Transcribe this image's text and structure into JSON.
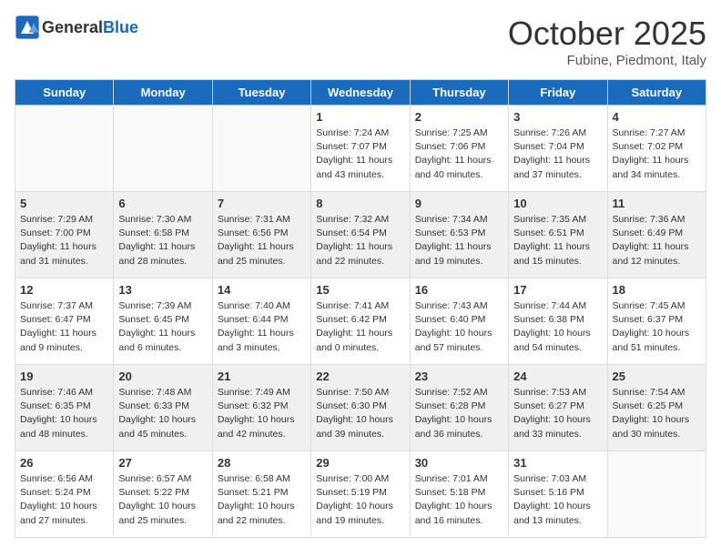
{
  "header": {
    "logo_general": "General",
    "logo_blue": "Blue",
    "month": "October 2025",
    "location": "Fubine, Piedmont, Italy"
  },
  "weekdays": [
    "Sunday",
    "Monday",
    "Tuesday",
    "Wednesday",
    "Thursday",
    "Friday",
    "Saturday"
  ],
  "weeks": [
    [
      {
        "date": "",
        "info": ""
      },
      {
        "date": "",
        "info": ""
      },
      {
        "date": "",
        "info": ""
      },
      {
        "date": "1",
        "info": "Sunrise: 7:24 AM\nSunset: 7:07 PM\nDaylight: 11 hours\nand 43 minutes."
      },
      {
        "date": "2",
        "info": "Sunrise: 7:25 AM\nSunset: 7:06 PM\nDaylight: 11 hours\nand 40 minutes."
      },
      {
        "date": "3",
        "info": "Sunrise: 7:26 AM\nSunset: 7:04 PM\nDaylight: 11 hours\nand 37 minutes."
      },
      {
        "date": "4",
        "info": "Sunrise: 7:27 AM\nSunset: 7:02 PM\nDaylight: 11 hours\nand 34 minutes."
      }
    ],
    [
      {
        "date": "5",
        "info": "Sunrise: 7:29 AM\nSunset: 7:00 PM\nDaylight: 11 hours\nand 31 minutes."
      },
      {
        "date": "6",
        "info": "Sunrise: 7:30 AM\nSunset: 6:58 PM\nDaylight: 11 hours\nand 28 minutes."
      },
      {
        "date": "7",
        "info": "Sunrise: 7:31 AM\nSunset: 6:56 PM\nDaylight: 11 hours\nand 25 minutes."
      },
      {
        "date": "8",
        "info": "Sunrise: 7:32 AM\nSunset: 6:54 PM\nDaylight: 11 hours\nand 22 minutes."
      },
      {
        "date": "9",
        "info": "Sunrise: 7:34 AM\nSunset: 6:53 PM\nDaylight: 11 hours\nand 19 minutes."
      },
      {
        "date": "10",
        "info": "Sunrise: 7:35 AM\nSunset: 6:51 PM\nDaylight: 11 hours\nand 15 minutes."
      },
      {
        "date": "11",
        "info": "Sunrise: 7:36 AM\nSunset: 6:49 PM\nDaylight: 11 hours\nand 12 minutes."
      }
    ],
    [
      {
        "date": "12",
        "info": "Sunrise: 7:37 AM\nSunset: 6:47 PM\nDaylight: 11 hours\nand 9 minutes."
      },
      {
        "date": "13",
        "info": "Sunrise: 7:39 AM\nSunset: 6:45 PM\nDaylight: 11 hours\nand 6 minutes."
      },
      {
        "date": "14",
        "info": "Sunrise: 7:40 AM\nSunset: 6:44 PM\nDaylight: 11 hours\nand 3 minutes."
      },
      {
        "date": "15",
        "info": "Sunrise: 7:41 AM\nSunset: 6:42 PM\nDaylight: 11 hours\nand 0 minutes."
      },
      {
        "date": "16",
        "info": "Sunrise: 7:43 AM\nSunset: 6:40 PM\nDaylight: 10 hours\nand 57 minutes."
      },
      {
        "date": "17",
        "info": "Sunrise: 7:44 AM\nSunset: 6:38 PM\nDaylight: 10 hours\nand 54 minutes."
      },
      {
        "date": "18",
        "info": "Sunrise: 7:45 AM\nSunset: 6:37 PM\nDaylight: 10 hours\nand 51 minutes."
      }
    ],
    [
      {
        "date": "19",
        "info": "Sunrise: 7:46 AM\nSunset: 6:35 PM\nDaylight: 10 hours\nand 48 minutes."
      },
      {
        "date": "20",
        "info": "Sunrise: 7:48 AM\nSunset: 6:33 PM\nDaylight: 10 hours\nand 45 minutes."
      },
      {
        "date": "21",
        "info": "Sunrise: 7:49 AM\nSunset: 6:32 PM\nDaylight: 10 hours\nand 42 minutes."
      },
      {
        "date": "22",
        "info": "Sunrise: 7:50 AM\nSunset: 6:30 PM\nDaylight: 10 hours\nand 39 minutes."
      },
      {
        "date": "23",
        "info": "Sunrise: 7:52 AM\nSunset: 6:28 PM\nDaylight: 10 hours\nand 36 minutes."
      },
      {
        "date": "24",
        "info": "Sunrise: 7:53 AM\nSunset: 6:27 PM\nDaylight: 10 hours\nand 33 minutes."
      },
      {
        "date": "25",
        "info": "Sunrise: 7:54 AM\nSunset: 6:25 PM\nDaylight: 10 hours\nand 30 minutes."
      }
    ],
    [
      {
        "date": "26",
        "info": "Sunrise: 6:56 AM\nSunset: 5:24 PM\nDaylight: 10 hours\nand 27 minutes."
      },
      {
        "date": "27",
        "info": "Sunrise: 6:57 AM\nSunset: 5:22 PM\nDaylight: 10 hours\nand 25 minutes."
      },
      {
        "date": "28",
        "info": "Sunrise: 6:58 AM\nSunset: 5:21 PM\nDaylight: 10 hours\nand 22 minutes."
      },
      {
        "date": "29",
        "info": "Sunrise: 7:00 AM\nSunset: 5:19 PM\nDaylight: 10 hours\nand 19 minutes."
      },
      {
        "date": "30",
        "info": "Sunrise: 7:01 AM\nSunset: 5:18 PM\nDaylight: 10 hours\nand 16 minutes."
      },
      {
        "date": "31",
        "info": "Sunrise: 7:03 AM\nSunset: 5:16 PM\nDaylight: 10 hours\nand 13 minutes."
      },
      {
        "date": "",
        "info": ""
      }
    ]
  ]
}
